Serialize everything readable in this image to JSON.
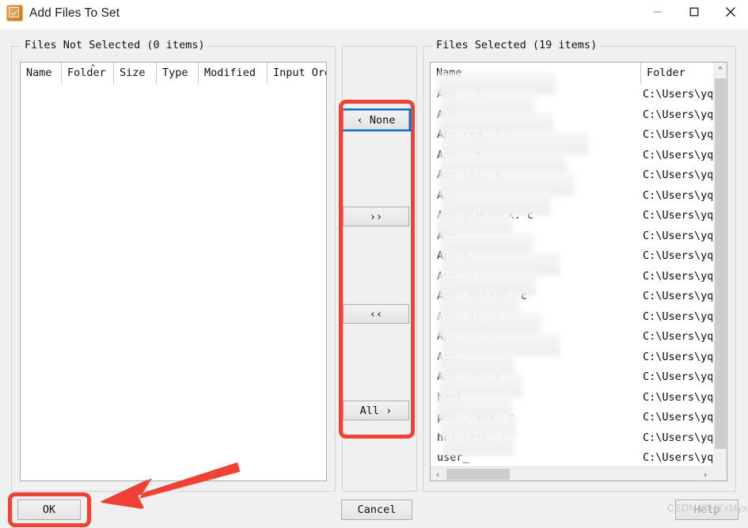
{
  "window": {
    "title": "Add Files To Set",
    "icon": "checkbox-orange-icon",
    "minimize_label": "—",
    "maximize_label": "□",
    "close_label": "✕"
  },
  "left_panel": {
    "group_title": "Files Not Selected (0 items)",
    "columns": [
      "Name",
      "Folder",
      "Size",
      "Type",
      "Modified",
      "Input Order"
    ],
    "sorted_column": "Folder",
    "sort_caret": "⌃",
    "rows": []
  },
  "right_panel": {
    "group_title": "Files Selected (19 items)",
    "columns": [
      "Name",
      "Folder"
    ],
    "rows": [
      {
        "name": "App                    . c",
        "folder": "C:\\Users\\yq_"
      },
      {
        "name": "App",
        "folder": "C:\\Users\\yq_"
      },
      {
        "name": "App                 rea. c",
        "folder": "C:\\Users\\yq_"
      },
      {
        "name": "App                 ..t.",
        "folder": "C:\\Users\\yq_"
      },
      {
        "name": "App                      ata. c",
        "folder": "C:\\Users\\yq_"
      },
      {
        "name": "App                          -",
        "folder": "C:\\Users\\yq_"
      },
      {
        "name": "App                gleCheck. c",
        "folder": "C:\\Users\\yq_"
      },
      {
        "name": "App",
        "folder": "C:\\Users\\yq_"
      },
      {
        "name": "App        c",
        "folder": "C:\\Users\\yq_"
      },
      {
        "name": "App.         --",
        "folder": "C:\\Users\\yq_"
      },
      {
        "name": "App.             action. c",
        "folder": "C:\\Users\\yq_"
      },
      {
        "name": "App_             it. c",
        "folder": "C:\\Users\\yq_"
      },
      {
        "name": "App.        s. c",
        "folder": "C:\\Users\\yq_"
      },
      {
        "name": "App.",
        "folder": "C:\\Users\\yq_"
      },
      {
        "name": "App.              sh. c",
        "folder": "C:\\Users\\yq_"
      },
      {
        "name": "banl",
        "folder": "C:\\Users\\yq_"
      },
      {
        "name": "pos         _task. c",
        "folder": "C:\\Users\\yq_"
      },
      {
        "name": "hos         cess. c",
        "folder": "C:\\Users\\yq_"
      },
      {
        "name": "user_",
        "folder": "C:\\Users\\yq_"
      }
    ],
    "vscroll": {
      "up_arrow": "⌃",
      "down_arrow": "⌄"
    },
    "hscroll": {
      "left_arrow": "‹",
      "right_arrow": "›"
    }
  },
  "transfer_buttons": {
    "none": "‹ None",
    "forward_all": "››",
    "backward_all": "‹‹",
    "all": "All ›",
    "focused": "none"
  },
  "dialog_buttons": {
    "ok": "OK",
    "cancel": "Cancel",
    "help": "Help"
  },
  "annotations": {
    "highlight_color": "#ef4136",
    "highlight_targets": [
      "transfer-button-column",
      "ok-button"
    ],
    "arrow_points_to": "ok-button"
  },
  "watermark": {
    "text": "CSDN @HYxMyx"
  }
}
